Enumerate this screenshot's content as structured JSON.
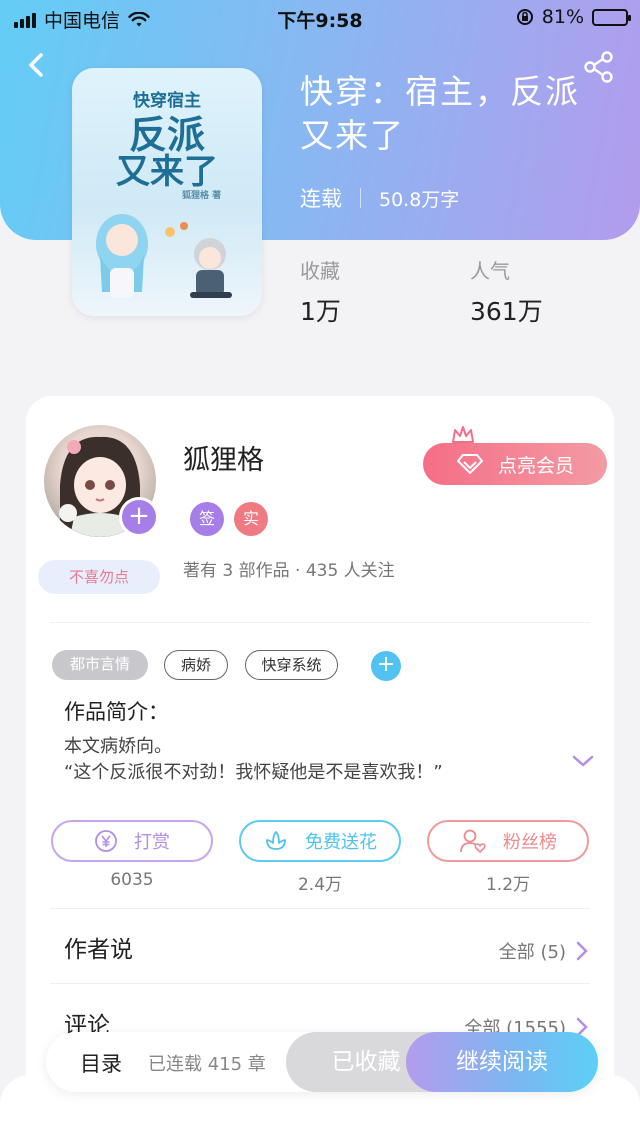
{
  "status_bar": {
    "carrier": "中国电信",
    "time": "下午9:58",
    "battery_percent": "81%"
  },
  "book": {
    "title": "快穿：宿主，反派又来了",
    "status": "连载",
    "word_count": "50.8万字",
    "cover_text": {
      "top": "快穿宿主",
      "main1": "反派",
      "main2": "又来了",
      "byline": "狐狸格 著"
    },
    "stats": [
      {
        "label": "收藏",
        "value": "1万"
      },
      {
        "label": "人气",
        "value": "361万"
      }
    ]
  },
  "author": {
    "name": "狐狸格",
    "badges": [
      {
        "text": "签",
        "color": "#a77de8"
      },
      {
        "text": "实",
        "color": "#f07a82"
      }
    ],
    "info": "著有 3 部作品 · 435 人关注",
    "mood_badge": "不喜勿点",
    "vip_button": "点亮会员"
  },
  "tags": [
    "都市言情",
    "病娇",
    "快穿系统"
  ],
  "intro": {
    "label": "作品简介：",
    "line1": "本文病娇向。",
    "line2": "“这个反派很不对劲！我怀疑他是不是喜欢我！”"
  },
  "actions": [
    {
      "label": "打赏",
      "count": "6035",
      "color": "#b993e6"
    },
    {
      "label": "免费送花",
      "count": "2.4万",
      "color": "#4fc3ee"
    },
    {
      "label": "粉丝榜",
      "count": "1.2万",
      "color": "#ef8a8d"
    }
  ],
  "sections": [
    {
      "title": "作者说",
      "right": "全部 (5)"
    },
    {
      "title": "评论",
      "right": "全部 (1555)"
    }
  ],
  "bottom_bar": {
    "toc": "目录",
    "chapters": "已连载 415 章",
    "collected": "已收藏",
    "continue": "继续阅读"
  },
  "colors": {
    "accent_purple": "#a77de8",
    "accent_blue": "#52c3f0",
    "vip_pink": "#f56e86"
  }
}
